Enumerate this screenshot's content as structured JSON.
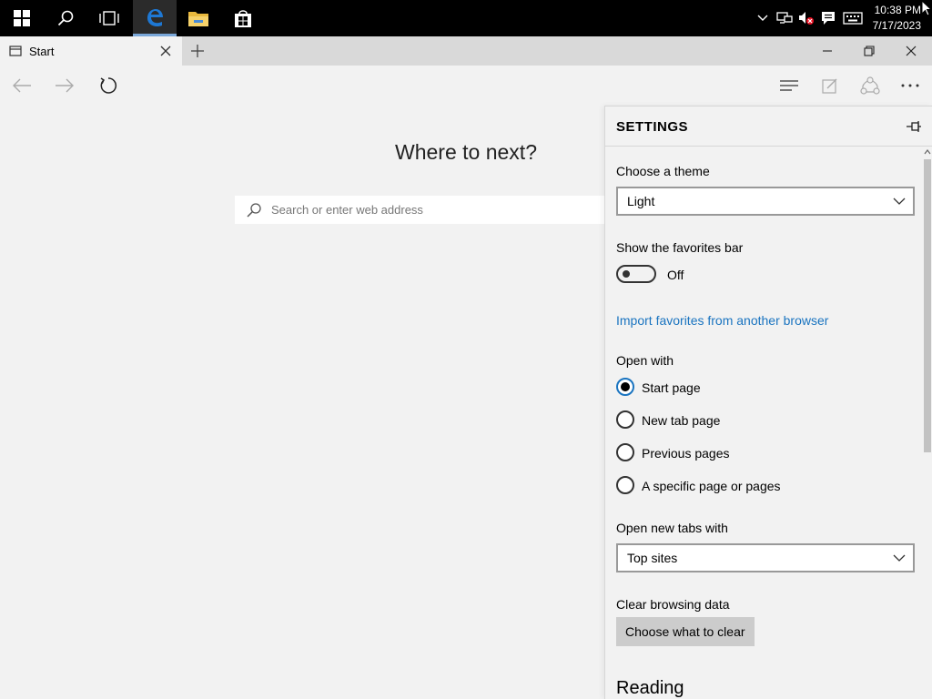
{
  "taskbar": {
    "clock_time": "10:38 PM",
    "clock_date": "7/17/2023",
    "icons": [
      "windows-start-icon",
      "search-icon",
      "task-view-icon",
      "edge-icon",
      "file-explorer-icon",
      "store-icon"
    ],
    "tray_icons": [
      "chevron-up-icon",
      "network-icon",
      "volume-muted-icon",
      "notification-icon",
      "keyboard-icon"
    ]
  },
  "browser": {
    "tab_title": "Start",
    "start_heading": "Where to next?",
    "search_placeholder": "Search or enter web address"
  },
  "settings": {
    "title": "SETTINGS",
    "theme_label": "Choose a theme",
    "theme_value": "Light",
    "favorites_bar_label": "Show the favorites bar",
    "favorites_bar_state": "Off",
    "import_link": "Import favorites from another browser",
    "open_with_label": "Open with",
    "open_with_options": [
      "Start page",
      "New tab page",
      "Previous pages",
      "A specific page or pages"
    ],
    "open_with_selected": "Start page",
    "new_tabs_label": "Open new tabs with",
    "new_tabs_value": "Top sites",
    "clear_data_label": "Clear browsing data",
    "clear_button": "Choose what to clear",
    "reading_title": "Reading"
  },
  "colors": {
    "accent": "#1a74c0",
    "taskbar": "#000000",
    "background": "#f2f2f2"
  }
}
